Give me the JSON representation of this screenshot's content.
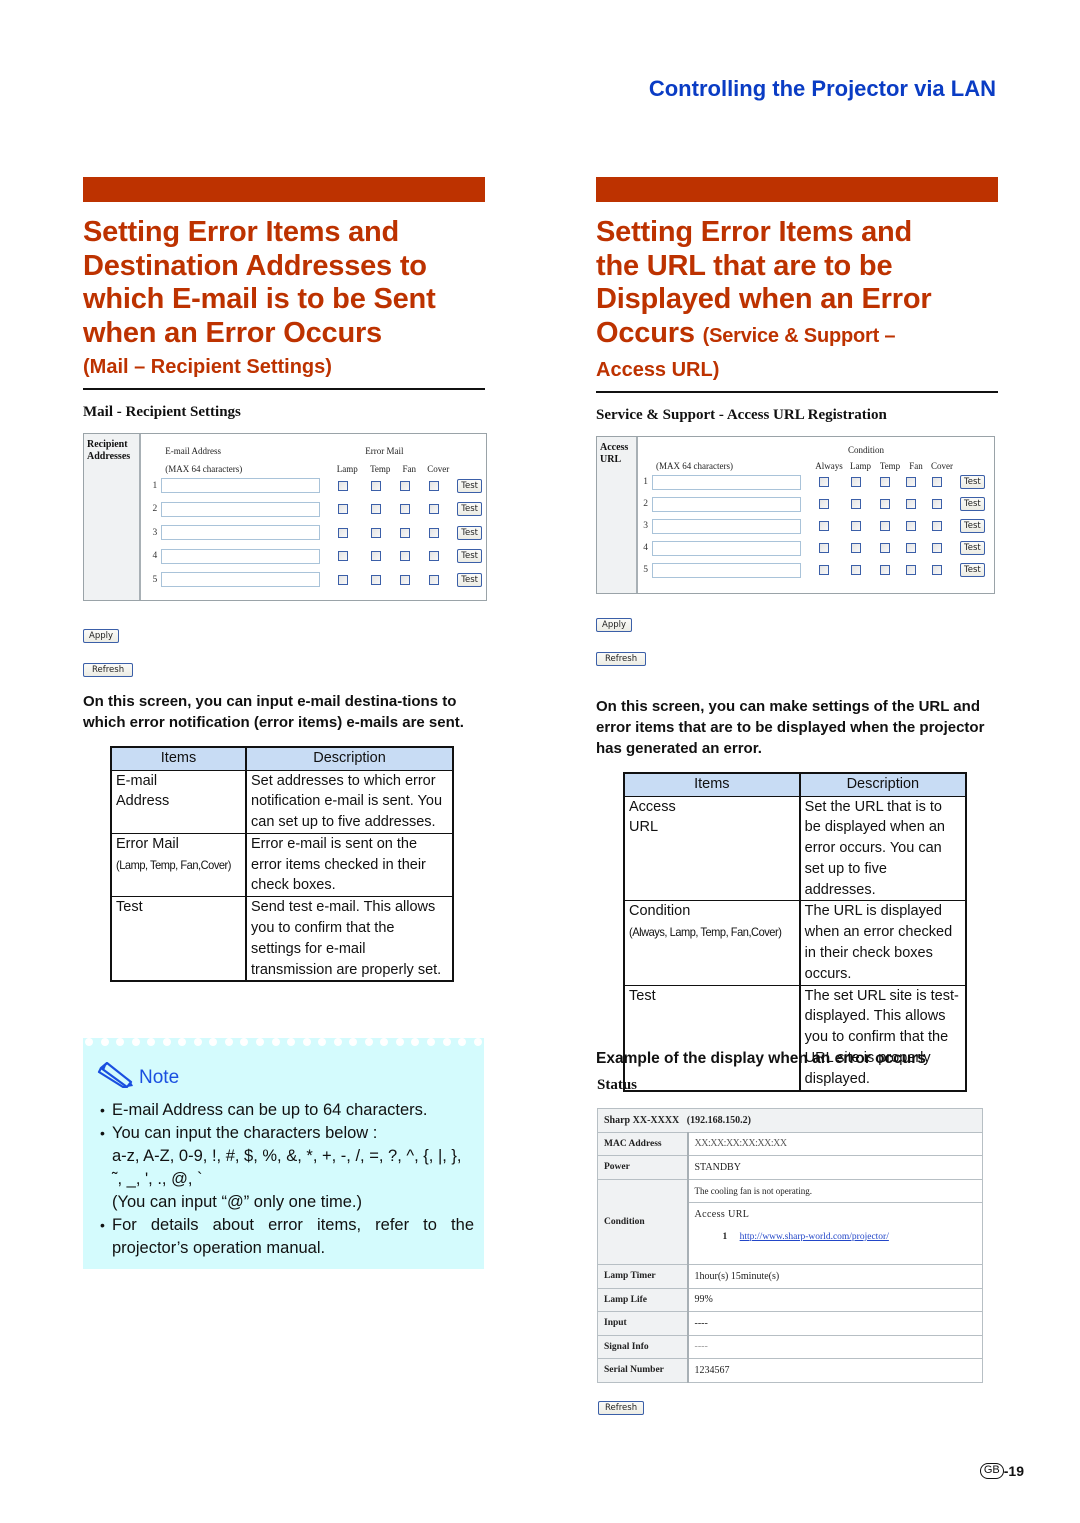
{
  "header": {
    "section": "Controlling the Projector via LAN"
  },
  "left": {
    "title_lines": [
      "Setting Error Items and",
      "Destination Addresses to",
      "which E-mail is to be Sent",
      "when an Error Occurs"
    ],
    "subtitle": "(Mail – Recipient Settings)",
    "web": {
      "heading": "Mail - Recipient Settings",
      "side_label_1": "Recipient",
      "side_label_2": "Addresses",
      "col_email": "E-mail Address",
      "col_max": "(MAX 64 characters)",
      "col_error": "Error Mail",
      "checkbox_cols": [
        "Lamp",
        "Temp",
        "Fan",
        "Cover"
      ],
      "rows": [
        {
          "num": "1",
          "value": ""
        },
        {
          "num": "2",
          "value": ""
        },
        {
          "num": "3",
          "value": ""
        },
        {
          "num": "4",
          "value": ""
        },
        {
          "num": "5",
          "value": ""
        }
      ],
      "test_label": "Test",
      "apply_label": "Apply",
      "refresh_label": "Refresh"
    },
    "lead": "On this screen, you can input e-mail destina-tions to which error notification (error items) e-mails are sent.",
    "table": {
      "headers": [
        "Items",
        "Description"
      ],
      "rows": [
        {
          "item": "E-mail",
          "item2": "Address",
          "item_small": "",
          "desc": "Set addresses to which error notification e-mail is sent. You can set up to five addresses."
        },
        {
          "item": "Error Mail",
          "item2": "",
          "item_small": "(Lamp, Temp, Fan,Cover)",
          "desc": "Error e-mail is sent on the error items checked in their check boxes."
        },
        {
          "item": "Test",
          "item2": "",
          "item_small": "",
          "desc": "Send test e-mail. This allows you to confirm that the settings for e-mail transmission are properly set."
        }
      ]
    },
    "note": {
      "label": "Note",
      "items": [
        "E-mail Address can be up to 64 characters.",
        "You can input the characters below :",
        "a-z, A-Z, 0-9, !, #, $, %, &, *, +, -, /, =, ?, ^, {, |, }, ˜, _, ', ., @, `",
        "(You can input “@” only one time.)",
        "For details about error items, refer to the projector’s operation manual."
      ]
    }
  },
  "right": {
    "title_lines": [
      "Setting Error Items and",
      "the URL that are to be",
      "Displayed when an Error"
    ],
    "title_last": "Occurs",
    "subtitle_inline": "(Service & Support –",
    "subtitle_line2": "Access URL)",
    "web": {
      "heading": "Service & Support - Access URL Registration",
      "side_label_1": "Access",
      "side_label_2": "URL",
      "col_condition": "Condition",
      "col_max": "(MAX 64 characters)",
      "checkbox_cols": [
        "Always",
        "Lamp",
        "Temp",
        "Fan",
        "Cover"
      ],
      "rows": [
        {
          "num": "1",
          "value": ""
        },
        {
          "num": "2",
          "value": ""
        },
        {
          "num": "3",
          "value": ""
        },
        {
          "num": "4",
          "value": ""
        },
        {
          "num": "5",
          "value": ""
        }
      ],
      "test_label": "Test",
      "apply_label": "Apply",
      "refresh_label": "Refresh"
    },
    "lead": "On this screen, you can make settings of the URL and error items that are to be displayed when the projector has generated an error.",
    "table": {
      "headers": [
        "Items",
        "Description"
      ],
      "rows": [
        {
          "item": "Access",
          "item2": "URL",
          "item_small": "",
          "desc": "Set the URL that is to be displayed when an error occurs. You can set up to five addresses."
        },
        {
          "item": "Condition",
          "item2": "",
          "item_small": "(Always, Lamp, Temp, Fan,Cover)",
          "desc": "The URL is displayed when an error checked in their check boxes occurs."
        },
        {
          "item": "Test",
          "item2": "",
          "item_small": "",
          "desc": "The set URL site is test-displayed. This allows you to confirm that the URL site is properly displayed."
        }
      ]
    },
    "example_heading": "Example of the display when an error occurs",
    "status": {
      "heading": "Status",
      "device": "Sharp XX-XXXX   (192.168.150.2)",
      "rows": [
        {
          "key": "MAC Address",
          "value": "XX:XX:XX:XX:XX:XX"
        },
        {
          "key": "Power",
          "value": "STANDBY"
        }
      ],
      "condition_key": "Condition",
      "condition_message": "The cooling fan is not operating.",
      "access_url_label": "Access URL",
      "access_url_num": "1",
      "access_url_link": "http://www.sharp-world.com/projector/",
      "rows2": [
        {
          "key": "Lamp Timer",
          "value": "1hour(s) 15minute(s)"
        },
        {
          "key": "Lamp Life",
          "value": "99%"
        },
        {
          "key": "Input",
          "value": "----"
        },
        {
          "key": "Signal Info",
          "value": "----"
        },
        {
          "key": "Serial Number",
          "value": "1234567"
        }
      ],
      "refresh_label": "Refresh"
    }
  },
  "footer": {
    "region": "GB",
    "page": "-19"
  }
}
